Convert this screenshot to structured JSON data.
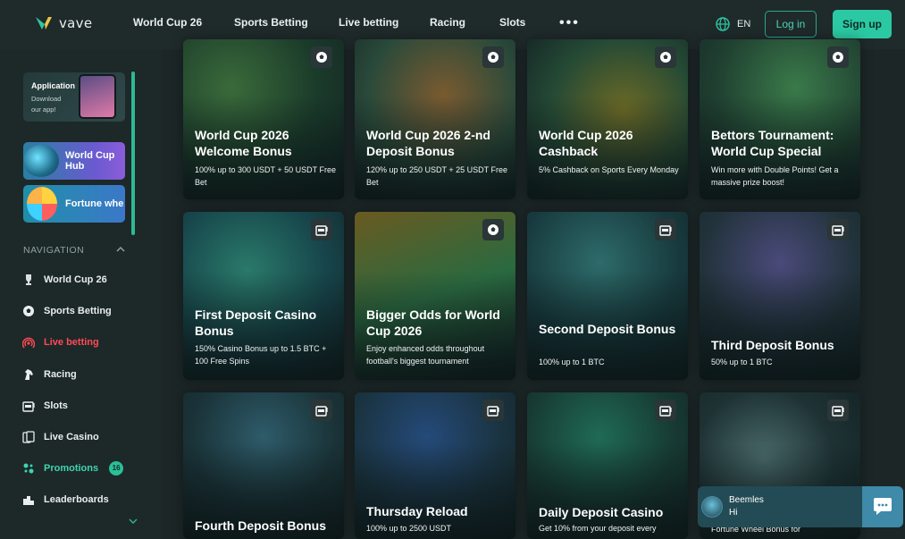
{
  "header": {
    "logo_text": "vave",
    "nav": [
      "World Cup 26",
      "Sports Betting",
      "Live betting",
      "Racing",
      "Slots"
    ],
    "more": "•••",
    "lang": "EN",
    "login": "Log in",
    "signup": "Sign up"
  },
  "sidebar": {
    "app_promo": {
      "title": "Application",
      "line1": "Download",
      "line2": "our app!"
    },
    "world_cup_hub": {
      "line1": "World Cup",
      "line2": "Hub"
    },
    "fortune_wheel": "Fortune whe",
    "nav_heading": "NAVIGATION",
    "items": [
      {
        "label": "World Cup 26",
        "icon": "trophy-icon"
      },
      {
        "label": "Sports Betting",
        "icon": "soccer-ball-icon"
      },
      {
        "label": "Live betting",
        "icon": "live-signal-icon"
      },
      {
        "label": "Racing",
        "icon": "horse-icon"
      },
      {
        "label": "Slots",
        "icon": "slot-machine-icon"
      },
      {
        "label": "Live Casino",
        "icon": "cards-icon"
      },
      {
        "label": "Promotions",
        "icon": "promotions-icon",
        "badge": "16"
      },
      {
        "label": "Leaderboards",
        "icon": "leaderboard-icon"
      }
    ]
  },
  "cards": [
    {
      "title": "World Cup 2026 Welcome Bonus",
      "desc": "100% up to 300 USDT + 50 USDT Free Bet",
      "tag": "soccer-ball-icon"
    },
    {
      "title": "World Cup 2026 2-nd Deposit Bonus",
      "desc": "120% up to 250 USDT + 25 USDT Free Bet",
      "tag": "soccer-ball-icon"
    },
    {
      "title": "World Cup 2026 Cashback",
      "desc": "5% Cashback on Sports Every Monday",
      "tag": "soccer-ball-icon"
    },
    {
      "title": "Bettors Tournament: World Cup Special",
      "desc": "Win more with Double Points! Get a massive prize boost!",
      "tag": "soccer-ball-icon"
    },
    {
      "title": "First Deposit Casino Bonus",
      "desc": "150% Casino Bonus up to 1.5 BTC + 100 Free Spins",
      "tag": "slot-machine-icon"
    },
    {
      "title": "Bigger Odds for World Cup 2026",
      "desc": "Enjoy enhanced odds throughout football's biggest tournament",
      "tag": "soccer-ball-icon"
    },
    {
      "title": "Second Deposit Bonus",
      "desc": "100% up to 1 BTC",
      "tag": "slot-machine-icon"
    },
    {
      "title": "Third Deposit Bonus",
      "desc": "50% up to 1 BTC",
      "tag": "slot-machine-icon"
    },
    {
      "title": "Fourth Deposit Bonus",
      "desc": "",
      "tag": "slot-machine-icon"
    },
    {
      "title": "Thursday Reload",
      "desc": "100% up to 2500 USDT",
      "tag": "slot-machine-icon"
    },
    {
      "title": "Daily Deposit Casino",
      "desc": "Get 10% from your deposit every",
      "tag": "slot-machine-icon"
    },
    {
      "title": "",
      "desc": "Fortune Wheel Bonus for",
      "tag": "slot-machine-icon"
    }
  ],
  "chat": {
    "name": "Beemles",
    "message": "Hi"
  },
  "colors": {
    "accent": "#2bc9a3",
    "live": "#ff4a55",
    "promo": "#3fd5b0"
  }
}
